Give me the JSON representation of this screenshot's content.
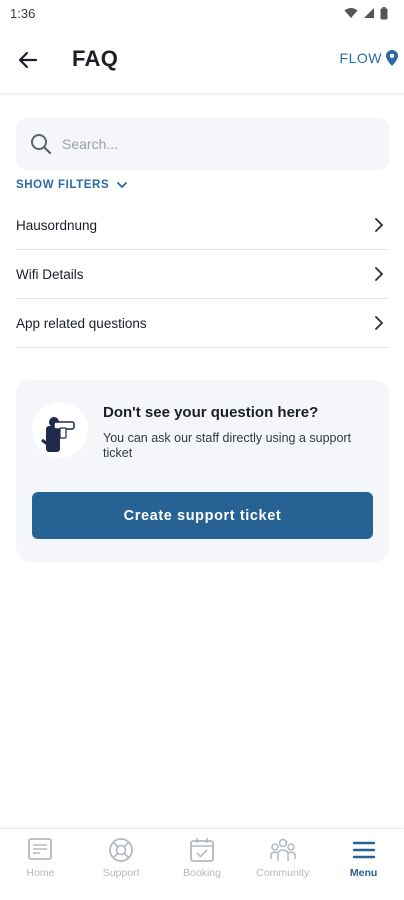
{
  "status_bar": {
    "time": "1:36"
  },
  "app_bar": {
    "title": "FAQ",
    "location_label": "FLOW"
  },
  "search": {
    "placeholder": "Search..."
  },
  "filters": {
    "label": "SHOW FILTERS"
  },
  "faq_items": [
    {
      "label": "Hausordnung"
    },
    {
      "label": "Wifi Details"
    },
    {
      "label": "App related questions"
    }
  ],
  "support_card": {
    "title": "Don't see your question here?",
    "description": "You can ask our staff directly using a support ticket",
    "button_label": "Create support ticket"
  },
  "bottom_nav": {
    "items": [
      {
        "label": "Home",
        "icon": "home-icon",
        "active": false
      },
      {
        "label": "Support",
        "icon": "support-icon",
        "active": false
      },
      {
        "label": "Booking",
        "icon": "booking-icon",
        "active": false
      },
      {
        "label": "Community",
        "icon": "community-icon",
        "active": false
      },
      {
        "label": "Menu",
        "icon": "menu-icon",
        "active": true
      }
    ]
  },
  "colors": {
    "accent": "#276294",
    "link": "#2b6aa3",
    "card_bg": "#f4f6f9",
    "nav_inactive": "#b3b9c2"
  }
}
